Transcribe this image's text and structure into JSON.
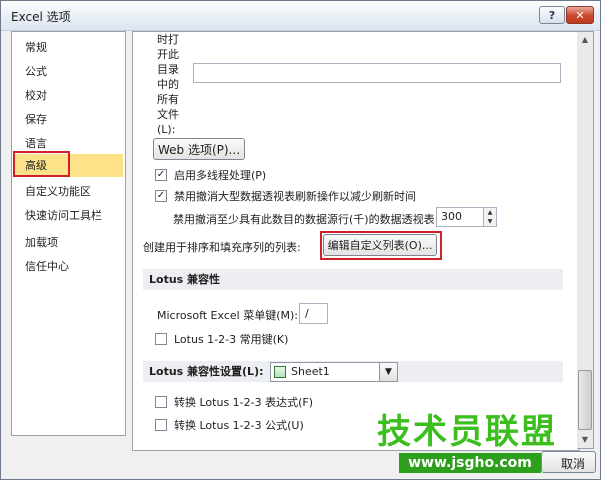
{
  "window": {
    "title": "Excel 选项",
    "help": "?",
    "close": "✕"
  },
  "nav": {
    "items": [
      "常规",
      "公式",
      "校对",
      "保存",
      "语言",
      "高级",
      "自定义功能区",
      "快速访问工具栏",
      "加载项",
      "信任中心"
    ],
    "selected_index": 5
  },
  "content": {
    "folder_label_chars": [
      "时打",
      "开此",
      "目录",
      "中的",
      "所有",
      "文件",
      "(L):"
    ],
    "web_options_button": "Web 选项(P)...",
    "multithread_label": "启用多线程处理(P)",
    "multithread_checked": true,
    "disable_undo_label": "禁用撤消大型数据透视表刷新操作以减少刷新时间",
    "disable_undo_checked": true,
    "undo_rows_label": "禁用撤消至少具有此数目的数据源行(千)的数据透视表:",
    "undo_rows_value": "300",
    "custom_list_label": "创建用于排序和填充序列的列表:",
    "edit_custom_lists_button": "编辑自定义列表(O)...",
    "lotus_section": "Lotus 兼容性",
    "menu_key_label": "Microsoft Excel 菜单键(M):",
    "menu_key_value": "/",
    "lotus_nav_keys_label": "Lotus 1-2-3 常用键(K)",
    "lotus_nav_keys_checked": false,
    "lotus_settings_label": "Lotus 兼容性设置(L):",
    "sheet_value": "Sheet1",
    "transition_formula_eval_label": "转换 Lotus 1-2-3 表达式(F)",
    "transition_formula_eval_checked": false,
    "transition_formula_entry_label": "转换 Lotus 1-2-3 公式(U)",
    "transition_formula_entry_checked": false
  },
  "footer": {
    "cancel_button": "取消"
  },
  "watermark": {
    "text": "技术员联盟",
    "url": "www.jsgho.com"
  }
}
